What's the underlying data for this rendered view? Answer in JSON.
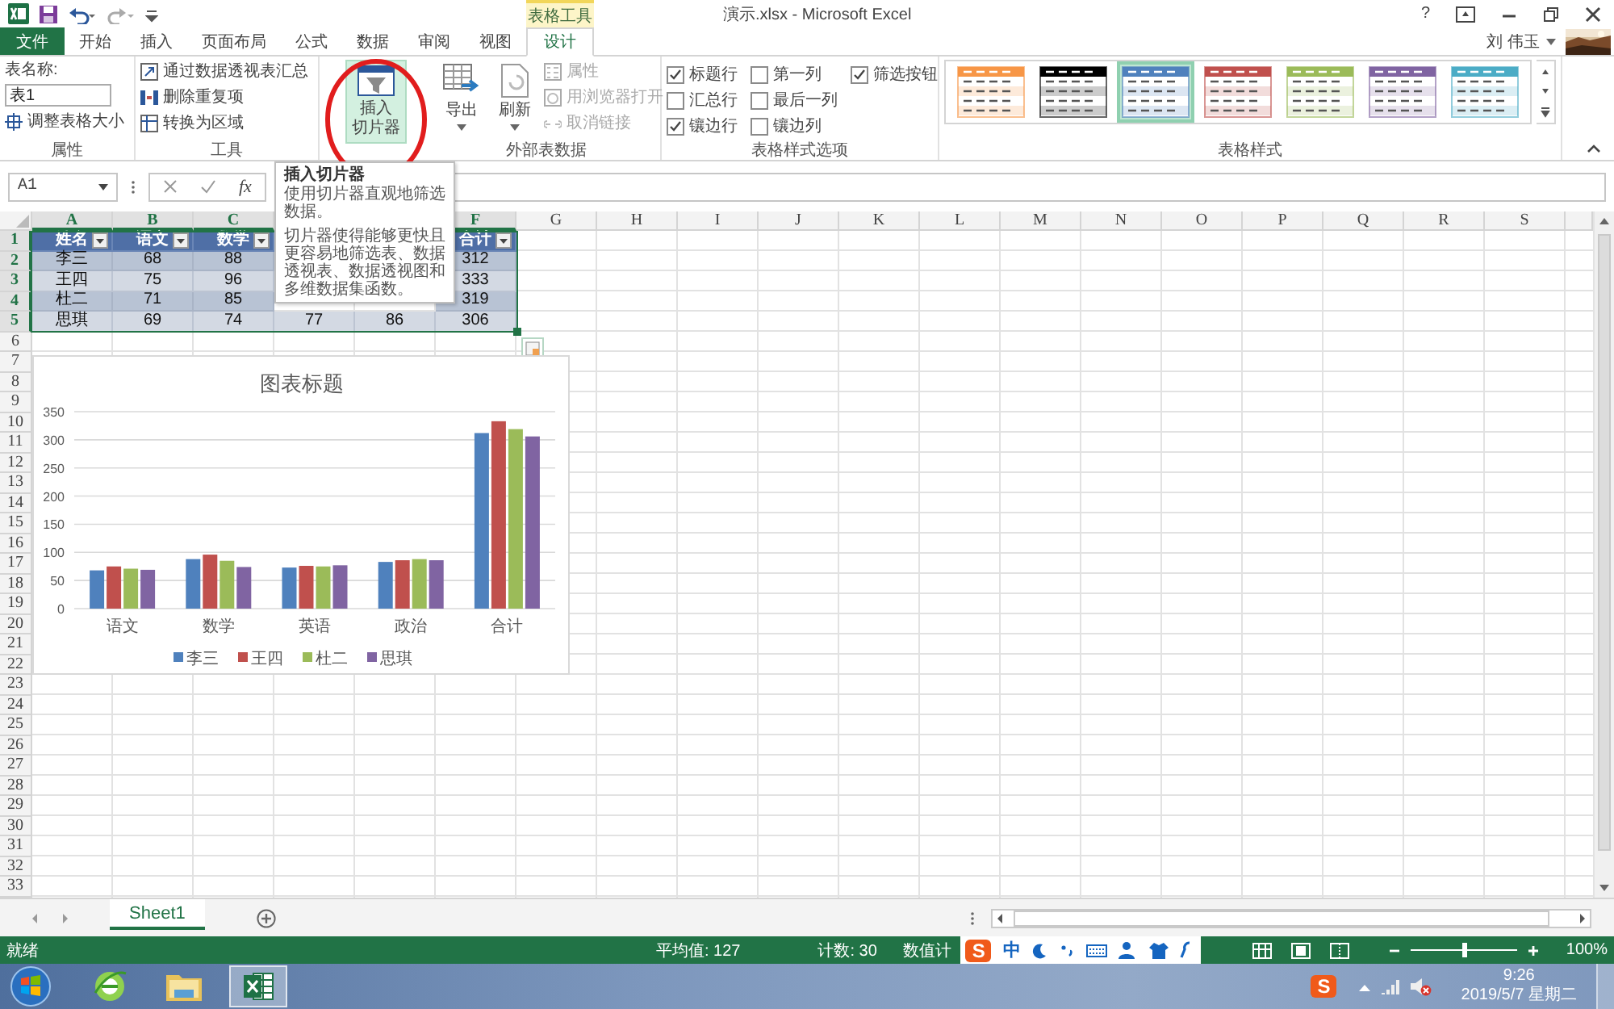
{
  "title_bar": {
    "context_tab_group": "表格工具",
    "title": "演示.xlsx - Microsoft Excel",
    "help_label": "?",
    "user_name": "刘 伟玉"
  },
  "ribbon_tabs": [
    {
      "label": "文件",
      "kind": "file",
      "selected": false
    },
    {
      "label": "开始",
      "kind": "normal",
      "selected": false
    },
    {
      "label": "插入",
      "kind": "normal",
      "selected": false
    },
    {
      "label": "页面布局",
      "kind": "normal",
      "selected": false
    },
    {
      "label": "公式",
      "kind": "normal",
      "selected": false
    },
    {
      "label": "数据",
      "kind": "normal",
      "selected": false
    },
    {
      "label": "审阅",
      "kind": "normal",
      "selected": false
    },
    {
      "label": "视图",
      "kind": "normal",
      "selected": false
    },
    {
      "label": "设计",
      "kind": "contextual",
      "selected": true
    }
  ],
  "ribbon": {
    "properties_group": {
      "label": "属性",
      "name_label": "表名称:",
      "name_value": "表1",
      "resize_label": "调整表格大小"
    },
    "tools_group": {
      "label": "工具",
      "items": [
        {
          "label": "通过数据透视表汇总",
          "kind": "pivot"
        },
        {
          "label": "删除重复项",
          "kind": "dedupe"
        },
        {
          "label": "转换为区域",
          "kind": "convert"
        }
      ]
    },
    "slicer_button": {
      "label_lines": [
        "插入",
        "切片器"
      ],
      "highlighted": true
    },
    "external_group": {
      "label": "外部表数据",
      "big_buttons": [
        {
          "label": "导出",
          "kind": "export"
        },
        {
          "label": "刷新",
          "kind": "refresh"
        }
      ],
      "small_buttons": [
        {
          "label": "属性",
          "kind": "properties",
          "disabled": true
        },
        {
          "label": "用浏览器打开",
          "kind": "browser",
          "disabled": true
        },
        {
          "label": "取消链接",
          "kind": "unlink",
          "disabled": true
        }
      ]
    },
    "style_options_group": {
      "label": "表格样式选项",
      "columns": [
        [
          {
            "label": "标题行",
            "checked": true
          },
          {
            "label": "汇总行",
            "checked": false
          },
          {
            "label": "镶边行",
            "checked": true
          }
        ],
        [
          {
            "label": "第一列",
            "checked": false
          },
          {
            "label": "最后一列",
            "checked": false
          },
          {
            "label": "镶边列",
            "checked": false
          }
        ],
        [
          {
            "label": "筛选按钮",
            "checked": true
          }
        ]
      ]
    },
    "styles_group": {
      "label": "表格样式",
      "styles": [
        {
          "color": "#f79646",
          "selected": false
        },
        {
          "color": "#000000",
          "selected": false
        },
        {
          "color": "#4f81bd",
          "selected": true
        },
        {
          "color": "#c0504d",
          "selected": false
        },
        {
          "color": "#9bbb59",
          "selected": false
        },
        {
          "color": "#8064a2",
          "selected": false
        },
        {
          "color": "#4bacc6",
          "selected": false
        }
      ]
    }
  },
  "tooltip": {
    "title": "插入切片器",
    "paragraphs": [
      "使用切片器直观地筛选数据。",
      "切片器使得能够更快且更容易地筛选表、数据透视表、数据透视图和多维数据集函数。"
    ]
  },
  "formula_bar": {
    "name_box": "A1",
    "function_label": "fx"
  },
  "sheet": {
    "columns": [
      {
        "label": "A",
        "selected": true
      },
      {
        "label": "B",
        "selected": true
      },
      {
        "label": "C",
        "selected": true
      },
      null,
      null,
      {
        "label": "F",
        "selected": true
      },
      {
        "label": "G",
        "selected": false
      },
      {
        "label": "H",
        "selected": false
      },
      {
        "label": "I",
        "selected": false
      },
      {
        "label": "J",
        "selected": false
      },
      {
        "label": "K",
        "selected": false
      },
      {
        "label": "L",
        "selected": false
      },
      {
        "label": "M",
        "selected": false
      },
      {
        "label": "N",
        "selected": false
      },
      {
        "label": "O",
        "selected": false
      },
      {
        "label": "P",
        "selected": false
      },
      {
        "label": "Q",
        "selected": false
      },
      {
        "label": "R",
        "selected": false
      },
      {
        "label": "S",
        "selected": false
      }
    ],
    "rows": [
      {
        "label": "1",
        "selected": true
      },
      {
        "label": "2",
        "selected": true
      },
      {
        "label": "3",
        "selected": true
      },
      {
        "label": "4",
        "selected": true
      },
      {
        "label": "5",
        "selected": true
      },
      {
        "label": "6",
        "selected": false
      },
      {
        "label": "7",
        "selected": false
      },
      {
        "label": "8",
        "selected": false
      },
      {
        "label": "9",
        "selected": false
      },
      {
        "label": "10",
        "selected": false
      },
      {
        "label": "11",
        "selected": false
      },
      {
        "label": "12",
        "selected": false
      },
      {
        "label": "13",
        "selected": false
      },
      {
        "label": "14",
        "selected": false
      },
      {
        "label": "15",
        "selected": false
      },
      {
        "label": "16",
        "selected": false
      },
      {
        "label": "17",
        "selected": false
      },
      {
        "label": "18",
        "selected": false
      },
      {
        "label": "19",
        "selected": false
      },
      {
        "label": "20",
        "selected": false
      },
      {
        "label": "21",
        "selected": false
      },
      {
        "label": "22",
        "selected": false
      },
      {
        "label": "23",
        "selected": false
      },
      {
        "label": "24",
        "selected": false
      },
      {
        "label": "25",
        "selected": false
      },
      {
        "label": "26",
        "selected": false
      },
      {
        "label": "27",
        "selected": false
      },
      {
        "label": "28",
        "selected": false
      },
      {
        "label": "29",
        "selected": false
      },
      {
        "label": "30",
        "selected": false
      },
      {
        "label": "31",
        "selected": false
      },
      {
        "label": "32",
        "selected": false
      },
      {
        "label": "33",
        "selected": false
      }
    ],
    "table": {
      "rows": [
        [
          "姓名",
          "语文",
          "数学",
          null,
          null,
          "合计"
        ],
        [
          "李三",
          "68",
          "88",
          null,
          null,
          "312"
        ],
        [
          "王四",
          "75",
          "96",
          null,
          null,
          "333"
        ],
        [
          "杜二",
          "71",
          "85",
          null,
          null,
          "319"
        ],
        [
          "思琪",
          "69",
          "74",
          "77",
          "86",
          "306"
        ]
      ]
    }
  },
  "chart": {
    "chart_data": {
      "type": "bar",
      "title": "图表标题",
      "categories": [
        "语文",
        "数学",
        "英语",
        "政治",
        "合计"
      ],
      "series": [
        {
          "name": "李三",
          "color": "#4f81bd",
          "values": [
            68,
            88,
            73,
            83,
            312
          ]
        },
        {
          "name": "王四",
          "color": "#c0504d",
          "values": [
            75,
            96,
            76,
            86,
            333
          ]
        },
        {
          "name": "杜二",
          "color": "#9bbb59",
          "values": [
            71,
            85,
            75,
            88,
            319
          ]
        },
        {
          "name": "思琪",
          "color": "#8064a2",
          "values": [
            69,
            74,
            77,
            86,
            306
          ]
        }
      ],
      "ylim": [
        0,
        350
      ],
      "yticks": [
        0,
        50,
        100,
        150,
        200,
        250,
        300,
        350
      ],
      "grid": true,
      "legend": true
    }
  },
  "sheet_tabs": [
    {
      "label": "Sheet1",
      "selected": true
    }
  ],
  "status_bar": {
    "ready": "就绪",
    "average": "平均值: 127",
    "count": "计数: 30",
    "numeric_count": "数值计",
    "zoom_slider": {
      "level": 0.5
    },
    "zoom": "100%"
  },
  "ime_toolbar": {
    "logo": "S",
    "mode": "中"
  },
  "taskbar": {
    "apps": [
      {
        "kind": "browser",
        "active": false
      },
      {
        "kind": "explorer",
        "active": false
      },
      {
        "kind": "excel",
        "active": true
      }
    ]
  },
  "tray": {
    "logo": "S",
    "time": "9:26",
    "date": "2019/5/7 星期二"
  }
}
